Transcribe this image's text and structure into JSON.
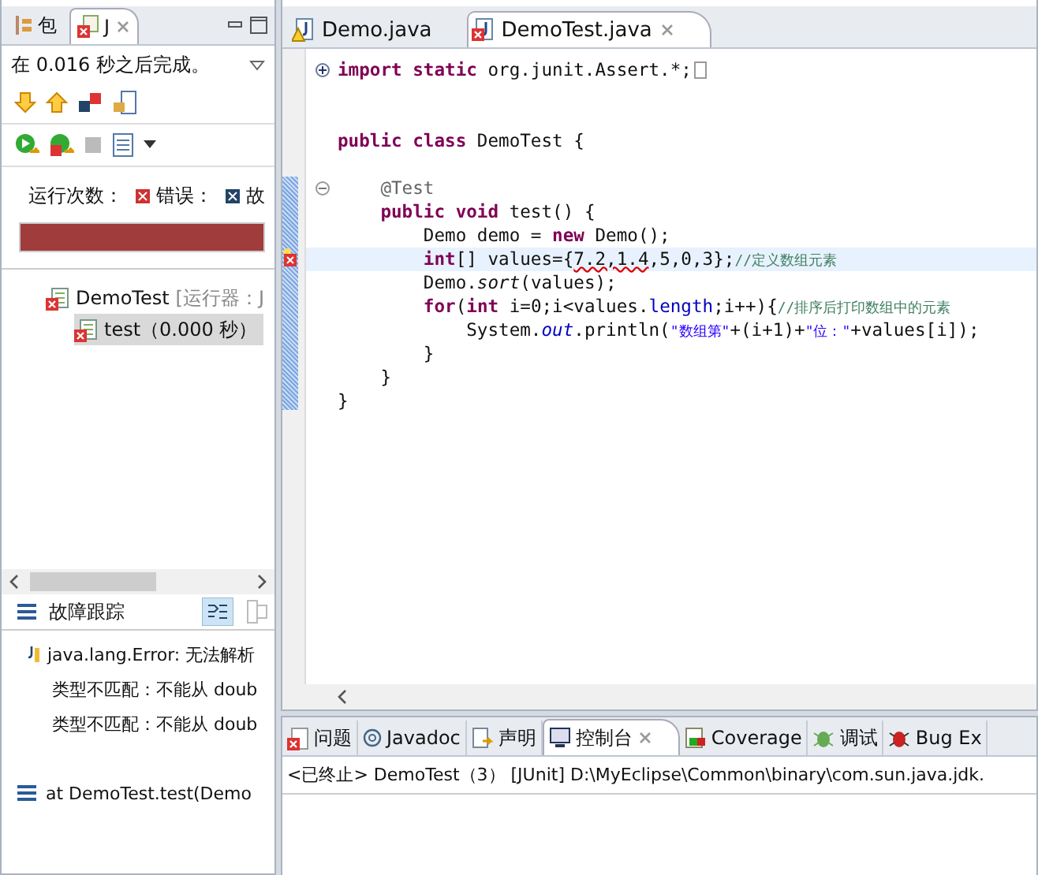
{
  "left_panel": {
    "tabs": [
      {
        "label": "包",
        "selected": false
      },
      {
        "label": "J",
        "selected": true
      }
    ],
    "status": "在 0.016 秒之后完成。",
    "counters": [
      {
        "label": "运行次数：",
        "kind": "plain"
      },
      {
        "label": "错误：",
        "kind": "error"
      },
      {
        "label": "故",
        "kind": "failure"
      }
    ],
    "progress": {
      "level": 1,
      "failed": true
    },
    "tree": [
      {
        "label": "DemoTest",
        "detail": "[运行器：J",
        "selected": false,
        "children": [
          {
            "label": "test（0.000 秒）",
            "selected": true
          }
        ]
      }
    ],
    "trace_title": "故障跟踪",
    "trace": [
      {
        "kind": "error",
        "text": "java.lang.Error: 无法解析"
      },
      {
        "kind": "detail",
        "text": "类型不匹配：不能从 doub"
      },
      {
        "kind": "detail",
        "text": "类型不匹配：不能从 doub"
      },
      {
        "kind": "blank"
      },
      {
        "kind": "frame",
        "text": "at DemoTest.test(Demo"
      }
    ]
  },
  "editor": {
    "tabs": [
      {
        "label": "Demo.java",
        "kind": "warning",
        "selected": false
      },
      {
        "label": "DemoTest.java",
        "kind": "error",
        "selected": true
      }
    ],
    "lines": [
      {
        "kind": "folded",
        "current": false,
        "error": false,
        "segments": [
          {
            "kind": "kw",
            "text": "import static"
          },
          {
            "kind": "plain",
            "text": " org.junit.Assert.*;"
          }
        ]
      },
      {
        "kind": "blank",
        "current": false,
        "error": false
      },
      {
        "kind": "blank",
        "current": false,
        "error": false
      },
      {
        "kind": "code",
        "current": false,
        "error": false,
        "segments": [
          {
            "kind": "kw",
            "text": "public class"
          },
          {
            "kind": "plain",
            "text": " DemoTest {"
          }
        ]
      },
      {
        "kind": "blank",
        "current": false,
        "error": false
      },
      {
        "kind": "fold_start",
        "current": false,
        "error": false,
        "segments": [
          {
            "kind": "annotation",
            "text": "    @Test"
          }
        ]
      },
      {
        "kind": "code",
        "current": false,
        "error": false,
        "segments": [
          {
            "kind": "kw",
            "text": "    public void"
          },
          {
            "kind": "plain",
            "text": " test() {"
          }
        ]
      },
      {
        "kind": "code",
        "current": false,
        "error": false,
        "segments": [
          {
            "kind": "plain",
            "text": "        Demo demo = "
          },
          {
            "kind": "kw",
            "text": "new"
          },
          {
            "kind": "plain",
            "text": " Demo();"
          }
        ]
      },
      {
        "kind": "code",
        "current": true,
        "error": true,
        "segments": [
          {
            "kind": "kw",
            "text": "        int"
          },
          {
            "kind": "plain",
            "text": "[] values={"
          },
          {
            "kind": "squiggle",
            "text": "7.2,1.4"
          },
          {
            "kind": "plain",
            "text": ",5,0,3};"
          },
          {
            "kind": "comment",
            "text": "//定义数组元素"
          }
        ]
      },
      {
        "kind": "code",
        "current": false,
        "error": false,
        "segments": [
          {
            "kind": "plain",
            "text": "        Demo."
          },
          {
            "kind": "italic",
            "text": "sort"
          },
          {
            "kind": "plain",
            "text": "(values);"
          }
        ]
      },
      {
        "kind": "code",
        "current": false,
        "error": false,
        "segments": [
          {
            "kind": "kw",
            "text": "        for"
          },
          {
            "kind": "plain",
            "text": "("
          },
          {
            "kind": "kw",
            "text": "int"
          },
          {
            "kind": "plain",
            "text": " i=0;i<values."
          },
          {
            "kind": "field",
            "text": "length"
          },
          {
            "kind": "plain",
            "text": ";i++){"
          },
          {
            "kind": "comment",
            "text": "//排序后打印数组中的元素"
          }
        ]
      },
      {
        "kind": "code",
        "current": false,
        "error": false,
        "segments": [
          {
            "kind": "plain",
            "text": "            System."
          },
          {
            "kind": "staticfield",
            "text": "out"
          },
          {
            "kind": "plain",
            "text": ".println("
          },
          {
            "kind": "string",
            "text": "\"数组第\""
          },
          {
            "kind": "plain",
            "text": "+(i+1)+"
          },
          {
            "kind": "string",
            "text": "\"位：\""
          },
          {
            "kind": "plain",
            "text": "+values[i]);"
          }
        ]
      },
      {
        "kind": "code",
        "current": false,
        "error": false,
        "segments": [
          {
            "kind": "plain",
            "text": "        }"
          }
        ]
      },
      {
        "kind": "code",
        "current": false,
        "error": false,
        "segments": [
          {
            "kind": "plain",
            "text": "    }"
          }
        ]
      },
      {
        "kind": "code",
        "current": false,
        "error": false,
        "segments": [
          {
            "kind": "plain",
            "text": "}"
          }
        ]
      }
    ]
  },
  "bottom_panel": {
    "tabs": [
      {
        "label": "问题",
        "selected": false
      },
      {
        "label": "Javadoc",
        "selected": false
      },
      {
        "label": "声明",
        "selected": false
      },
      {
        "label": "控制台",
        "selected": true
      },
      {
        "label": "Coverage",
        "selected": false
      },
      {
        "label": "调试",
        "selected": false
      },
      {
        "label": "Bug Ex",
        "selected": false
      }
    ],
    "console_header": "<已终止> DemoTest（3） [JUnit] D:\\MyEclipse\\Common\\binary\\com.sun.java.jdk."
  }
}
